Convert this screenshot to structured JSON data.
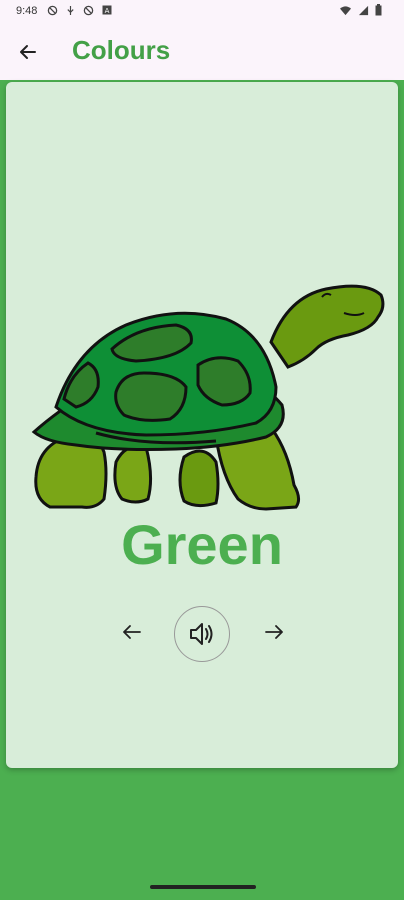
{
  "status_bar": {
    "time": "9:48",
    "icons_left": [
      "notification-blocked-icon",
      "usb-icon",
      "notification-blocked-icon",
      "app-icon"
    ],
    "icons_right": [
      "wifi-icon",
      "signal-icon",
      "battery-icon"
    ]
  },
  "appbar": {
    "back_icon": "arrow-left-icon",
    "title": "Colours"
  },
  "card": {
    "image": "turtle-illustration",
    "word": "Green",
    "controls": {
      "prev_icon": "arrow-left-icon",
      "sound_icon": "speaker-icon",
      "next_icon": "arrow-right-icon"
    }
  },
  "colors": {
    "accent": "#4CAF50",
    "title": "#43A047",
    "card_bg": "#D8EDD9",
    "appbar_bg": "#FBF4FB"
  }
}
